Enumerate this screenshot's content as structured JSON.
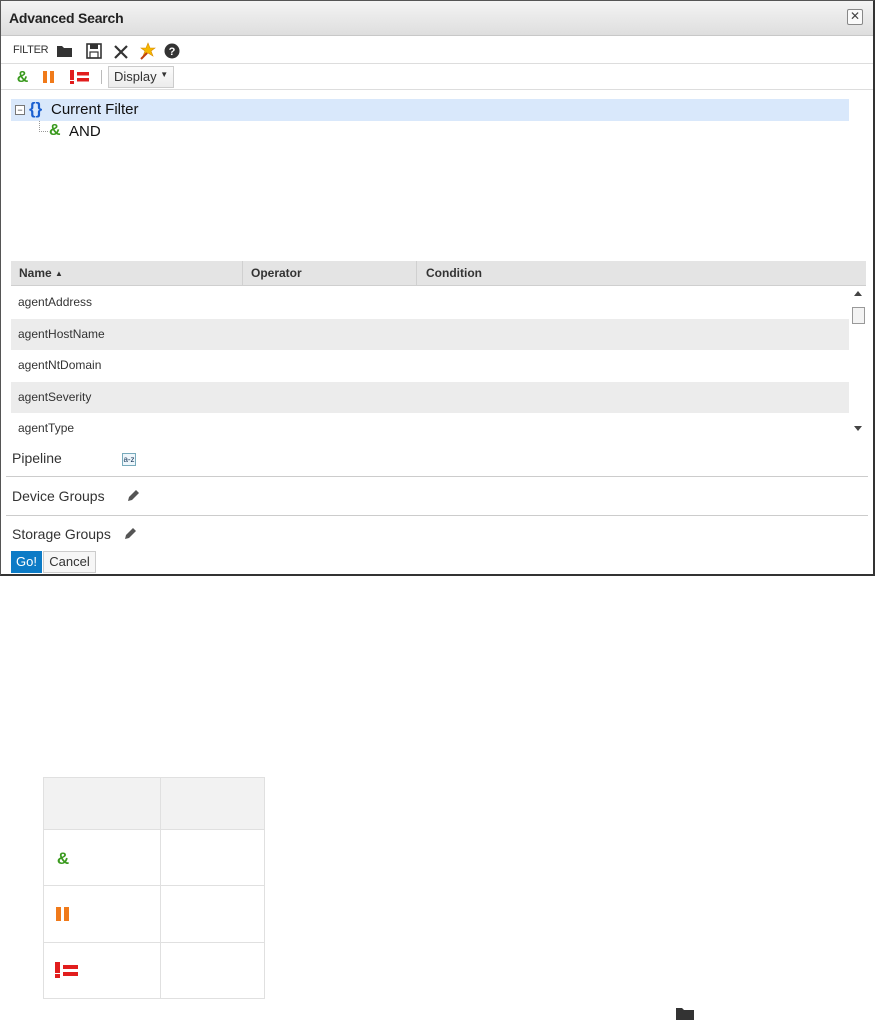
{
  "dialog": {
    "title": "Advanced Search",
    "close_label": "✕"
  },
  "toolbar": {
    "filter_label": "FILTER",
    "icons": [
      "folder-open-icon",
      "save-icon",
      "clear-icon",
      "wand-icon",
      "help-icon"
    ],
    "display_label": "Display"
  },
  "operators": [
    "and-icon",
    "or-icon",
    "not-equal-icon"
  ],
  "tree": {
    "root_label": "Current Filter",
    "child_label": "AND"
  },
  "grid": {
    "columns": {
      "name": "Name",
      "operator": "Operator",
      "condition": "Condition"
    },
    "rows": [
      "agentAddress",
      "agentHostName",
      "agentNtDomain",
      "agentSeverity",
      "agentType"
    ]
  },
  "sections": {
    "pipeline": "Pipeline",
    "pipeline_badge": "a-z",
    "device_groups": "Device Groups",
    "storage_groups": "Storage Groups"
  },
  "actions": {
    "go": "Go!",
    "cancel": "Cancel"
  },
  "colors": {
    "and_green": "#3a9a1e",
    "or_orange": "#f07a1a",
    "not_red": "#e11d1d",
    "go_blue": "#0c7bc6"
  }
}
